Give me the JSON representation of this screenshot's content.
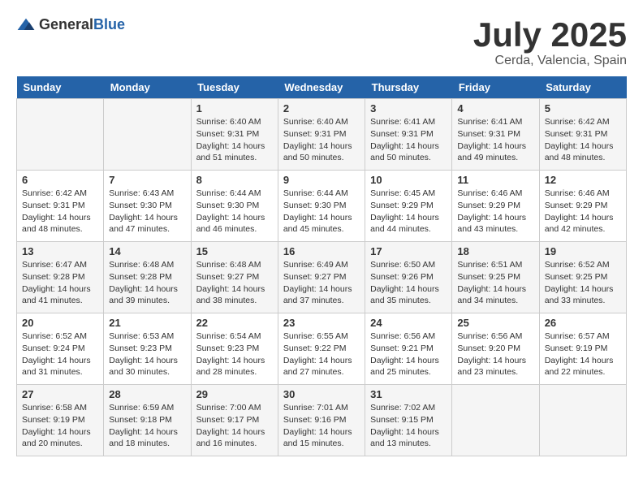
{
  "logo": {
    "general": "General",
    "blue": "Blue"
  },
  "header": {
    "month": "July 2025",
    "location": "Cerda, Valencia, Spain"
  },
  "weekdays": [
    "Sunday",
    "Monday",
    "Tuesday",
    "Wednesday",
    "Thursday",
    "Friday",
    "Saturday"
  ],
  "weeks": [
    [
      {
        "day": "",
        "sunrise": "",
        "sunset": "",
        "daylight": ""
      },
      {
        "day": "",
        "sunrise": "",
        "sunset": "",
        "daylight": ""
      },
      {
        "day": "1",
        "sunrise": "Sunrise: 6:40 AM",
        "sunset": "Sunset: 9:31 PM",
        "daylight": "Daylight: 14 hours and 51 minutes."
      },
      {
        "day": "2",
        "sunrise": "Sunrise: 6:40 AM",
        "sunset": "Sunset: 9:31 PM",
        "daylight": "Daylight: 14 hours and 50 minutes."
      },
      {
        "day": "3",
        "sunrise": "Sunrise: 6:41 AM",
        "sunset": "Sunset: 9:31 PM",
        "daylight": "Daylight: 14 hours and 50 minutes."
      },
      {
        "day": "4",
        "sunrise": "Sunrise: 6:41 AM",
        "sunset": "Sunset: 9:31 PM",
        "daylight": "Daylight: 14 hours and 49 minutes."
      },
      {
        "day": "5",
        "sunrise": "Sunrise: 6:42 AM",
        "sunset": "Sunset: 9:31 PM",
        "daylight": "Daylight: 14 hours and 48 minutes."
      }
    ],
    [
      {
        "day": "6",
        "sunrise": "Sunrise: 6:42 AM",
        "sunset": "Sunset: 9:31 PM",
        "daylight": "Daylight: 14 hours and 48 minutes."
      },
      {
        "day": "7",
        "sunrise": "Sunrise: 6:43 AM",
        "sunset": "Sunset: 9:30 PM",
        "daylight": "Daylight: 14 hours and 47 minutes."
      },
      {
        "day": "8",
        "sunrise": "Sunrise: 6:44 AM",
        "sunset": "Sunset: 9:30 PM",
        "daylight": "Daylight: 14 hours and 46 minutes."
      },
      {
        "day": "9",
        "sunrise": "Sunrise: 6:44 AM",
        "sunset": "Sunset: 9:30 PM",
        "daylight": "Daylight: 14 hours and 45 minutes."
      },
      {
        "day": "10",
        "sunrise": "Sunrise: 6:45 AM",
        "sunset": "Sunset: 9:29 PM",
        "daylight": "Daylight: 14 hours and 44 minutes."
      },
      {
        "day": "11",
        "sunrise": "Sunrise: 6:46 AM",
        "sunset": "Sunset: 9:29 PM",
        "daylight": "Daylight: 14 hours and 43 minutes."
      },
      {
        "day": "12",
        "sunrise": "Sunrise: 6:46 AM",
        "sunset": "Sunset: 9:29 PM",
        "daylight": "Daylight: 14 hours and 42 minutes."
      }
    ],
    [
      {
        "day": "13",
        "sunrise": "Sunrise: 6:47 AM",
        "sunset": "Sunset: 9:28 PM",
        "daylight": "Daylight: 14 hours and 41 minutes."
      },
      {
        "day": "14",
        "sunrise": "Sunrise: 6:48 AM",
        "sunset": "Sunset: 9:28 PM",
        "daylight": "Daylight: 14 hours and 39 minutes."
      },
      {
        "day": "15",
        "sunrise": "Sunrise: 6:48 AM",
        "sunset": "Sunset: 9:27 PM",
        "daylight": "Daylight: 14 hours and 38 minutes."
      },
      {
        "day": "16",
        "sunrise": "Sunrise: 6:49 AM",
        "sunset": "Sunset: 9:27 PM",
        "daylight": "Daylight: 14 hours and 37 minutes."
      },
      {
        "day": "17",
        "sunrise": "Sunrise: 6:50 AM",
        "sunset": "Sunset: 9:26 PM",
        "daylight": "Daylight: 14 hours and 35 minutes."
      },
      {
        "day": "18",
        "sunrise": "Sunrise: 6:51 AM",
        "sunset": "Sunset: 9:25 PM",
        "daylight": "Daylight: 14 hours and 34 minutes."
      },
      {
        "day": "19",
        "sunrise": "Sunrise: 6:52 AM",
        "sunset": "Sunset: 9:25 PM",
        "daylight": "Daylight: 14 hours and 33 minutes."
      }
    ],
    [
      {
        "day": "20",
        "sunrise": "Sunrise: 6:52 AM",
        "sunset": "Sunset: 9:24 PM",
        "daylight": "Daylight: 14 hours and 31 minutes."
      },
      {
        "day": "21",
        "sunrise": "Sunrise: 6:53 AM",
        "sunset": "Sunset: 9:23 PM",
        "daylight": "Daylight: 14 hours and 30 minutes."
      },
      {
        "day": "22",
        "sunrise": "Sunrise: 6:54 AM",
        "sunset": "Sunset: 9:23 PM",
        "daylight": "Daylight: 14 hours and 28 minutes."
      },
      {
        "day": "23",
        "sunrise": "Sunrise: 6:55 AM",
        "sunset": "Sunset: 9:22 PM",
        "daylight": "Daylight: 14 hours and 27 minutes."
      },
      {
        "day": "24",
        "sunrise": "Sunrise: 6:56 AM",
        "sunset": "Sunset: 9:21 PM",
        "daylight": "Daylight: 14 hours and 25 minutes."
      },
      {
        "day": "25",
        "sunrise": "Sunrise: 6:56 AM",
        "sunset": "Sunset: 9:20 PM",
        "daylight": "Daylight: 14 hours and 23 minutes."
      },
      {
        "day": "26",
        "sunrise": "Sunrise: 6:57 AM",
        "sunset": "Sunset: 9:19 PM",
        "daylight": "Daylight: 14 hours and 22 minutes."
      }
    ],
    [
      {
        "day": "27",
        "sunrise": "Sunrise: 6:58 AM",
        "sunset": "Sunset: 9:19 PM",
        "daylight": "Daylight: 14 hours and 20 minutes."
      },
      {
        "day": "28",
        "sunrise": "Sunrise: 6:59 AM",
        "sunset": "Sunset: 9:18 PM",
        "daylight": "Daylight: 14 hours and 18 minutes."
      },
      {
        "day": "29",
        "sunrise": "Sunrise: 7:00 AM",
        "sunset": "Sunset: 9:17 PM",
        "daylight": "Daylight: 14 hours and 16 minutes."
      },
      {
        "day": "30",
        "sunrise": "Sunrise: 7:01 AM",
        "sunset": "Sunset: 9:16 PM",
        "daylight": "Daylight: 14 hours and 15 minutes."
      },
      {
        "day": "31",
        "sunrise": "Sunrise: 7:02 AM",
        "sunset": "Sunset: 9:15 PM",
        "daylight": "Daylight: 14 hours and 13 minutes."
      },
      {
        "day": "",
        "sunrise": "",
        "sunset": "",
        "daylight": ""
      },
      {
        "day": "",
        "sunrise": "",
        "sunset": "",
        "daylight": ""
      }
    ]
  ]
}
